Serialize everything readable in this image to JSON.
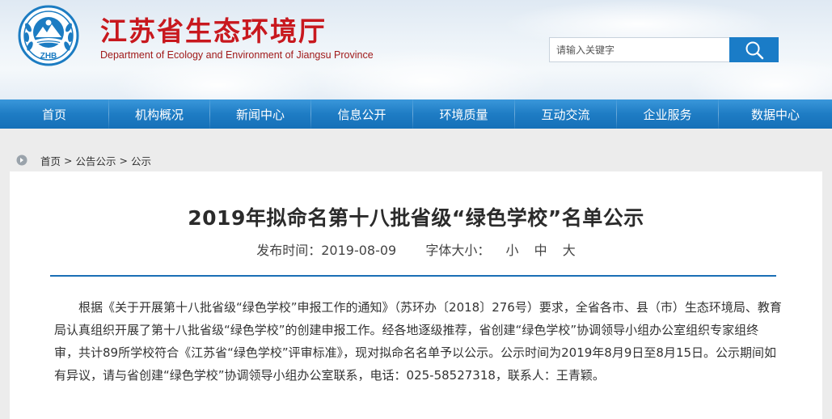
{
  "site": {
    "title_cn": "江苏省生态环境厅",
    "title_en": "Department of Ecology and Environment of Jiangsu Province",
    "logo_text": "ZHB",
    "logo_icon": "environment-emblem-icon",
    "brand_red": "#c8181e",
    "brand_blue": "#1a7cc7"
  },
  "search": {
    "placeholder": "请输入关键字",
    "button_icon": "search-icon"
  },
  "nav": {
    "items": [
      {
        "label": "首页"
      },
      {
        "label": "机构概况"
      },
      {
        "label": "新闻中心"
      },
      {
        "label": "信息公开"
      },
      {
        "label": "环境质量"
      },
      {
        "label": "互动交流"
      },
      {
        "label": "企业服务"
      },
      {
        "label": "数据中心"
      }
    ]
  },
  "breadcrumb": {
    "icon": "location-icon",
    "items": [
      "首页",
      "公告公示",
      "公示"
    ],
    "separator": ">"
  },
  "article": {
    "title": "2019年拟命名第十八批省级“绿色学校”名单公示",
    "publish_label": "发布时间：",
    "publish_date": "2019-08-09",
    "font_size_label": "字体大小：",
    "font_sizes": [
      "小",
      "中",
      "大"
    ],
    "body": "根据《关于开展第十八批省级“绿色学校”申报工作的通知》（苏环办〔2018〕276号）要求，全省各市、县（市）生态环境局、教育局认真组织开展了第十八批省级“绿色学校”的创建申报工作。经各地逐级推荐，省创建“绿色学校”协调领导小组办公室组织专家组终审，共计89所学校符合《江苏省“绿色学校”评审标准》，现对拟命名名单予以公示。公示时间为2019年8月9日至8月15日。公示期间如有异议，请与省创建“绿色学校”协调领导小组办公室联系，电话：025-58527318，联系人：王青颖。"
  }
}
